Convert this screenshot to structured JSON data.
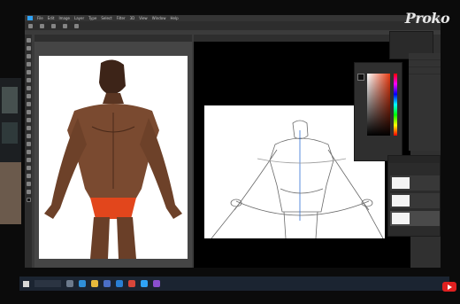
{
  "app": {
    "menu": [
      "File",
      "Edit",
      "Image",
      "Layer",
      "Type",
      "Select",
      "Filter",
      "3D",
      "View",
      "Window",
      "Help"
    ]
  },
  "brand": {
    "logo_text": "Proko"
  },
  "colors": {
    "picker_hue": "#e83b12",
    "ps_accent": "#2fa3f7",
    "taskbar": "#1b2431",
    "youtube": "#e02020"
  },
  "taskbar": {
    "icons": [
      "windows-icon",
      "search-icon",
      "task-view-icon",
      "edge-icon",
      "explorer-icon",
      "store-icon",
      "mail-icon",
      "chrome-icon",
      "photoshop-icon",
      "media-icon"
    ]
  }
}
